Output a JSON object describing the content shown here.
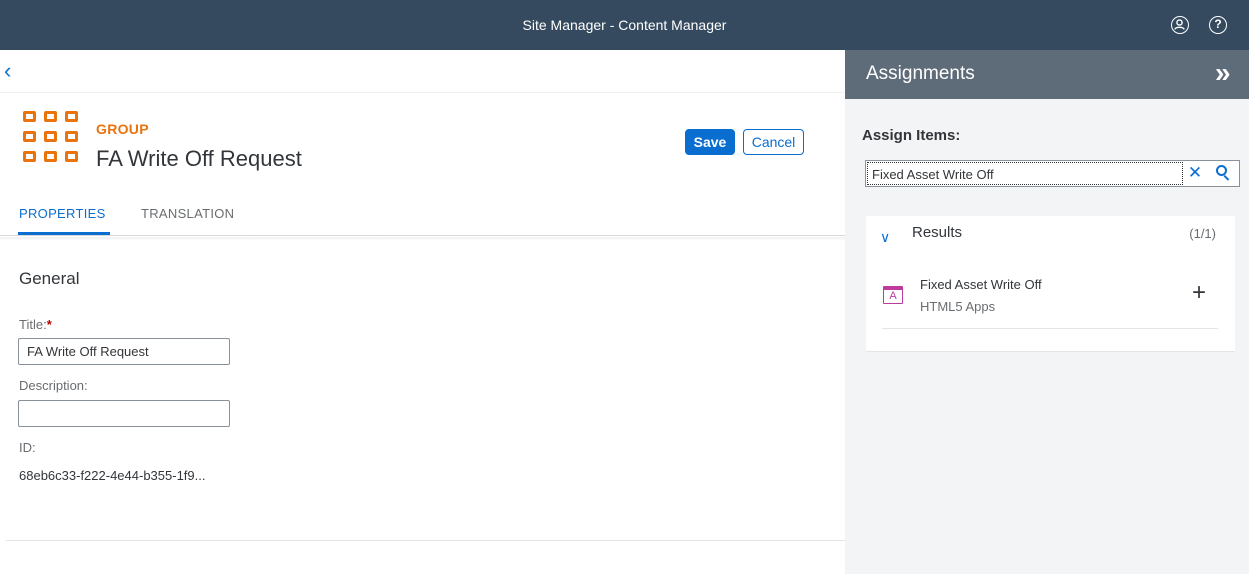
{
  "shell": {
    "title": "Site Manager - Content Manager",
    "profile_icon": "profile-icon",
    "help_icon": "help-icon",
    "help_glyph": "?"
  },
  "header": {
    "back_glyph": "‹",
    "type_label": "GROUP",
    "title": "FA Write Off Request",
    "save_label": "Save",
    "cancel_label": "Cancel"
  },
  "tabs": [
    {
      "label": "PROPERTIES",
      "selected": true
    },
    {
      "label": "TRANSLATION",
      "selected": false
    }
  ],
  "general": {
    "section_title": "General",
    "title_label": "Title:",
    "required_marker": "*",
    "title_value": "FA Write Off Request",
    "description_label": "Description:",
    "description_value": "",
    "id_label": "ID:",
    "id_value": "68eb6c33-f222-4e44-b355-1f9..."
  },
  "assignments": {
    "panel_title": "Assignments",
    "collapse_glyph": "»",
    "assign_label": "Assign Items:",
    "search_value": "Fixed Asset Write Off",
    "clear_glyph": "✕",
    "results_title": "Results",
    "results_count": "(1/1)",
    "chevron_glyph": "∨",
    "results": [
      {
        "name": "Fixed Asset Write Off",
        "type": "HTML5 Apps",
        "icon_glyph": "A",
        "add_glyph": "+"
      }
    ]
  },
  "colors": {
    "shell": "#354a5f",
    "brand_blue": "#0a6ed1",
    "group_orange": "#e9730c",
    "side_header": "#5e6b78",
    "app_icon": "#c0399f"
  }
}
